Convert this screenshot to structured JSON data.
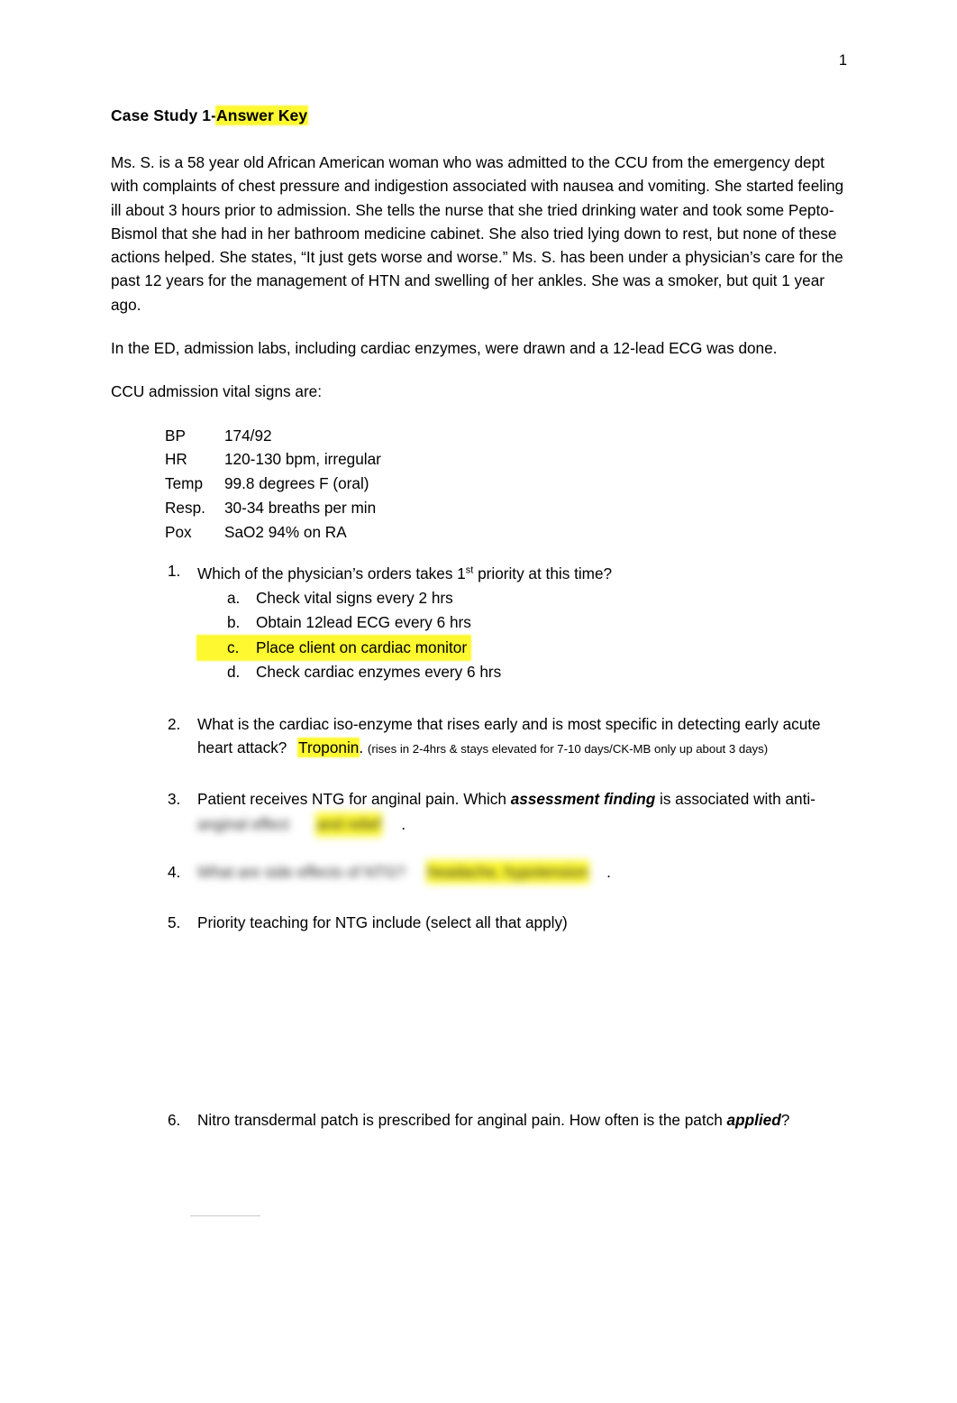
{
  "page": {
    "number": "1"
  },
  "document": {
    "title_prefix": "Case Study 1-",
    "title_highlight": "Answer Key",
    "paragraphs": [
      "Ms. S. is a 58 year old African American woman who was admitted to the CCU from the emergency dept with complaints of chest pressure and indigestion associated with nausea and vomiting. She started feeling ill about 3 hours prior to admission.  She tells the nurse that she tried drinking water and took some Pepto-Bismol that she had in her bathroom medicine cabinet. She also tried lying down to rest, but none of these actions helped.  She states, “It just gets worse and worse.”  Ms. S. has been under a physician’s care for the past 12 years for the management of HTN and swelling of her ankles.  She was a smoker, but quit 1 year ago.",
      "In the ED, admission labs, including cardiac enzymes, were drawn and a 12-lead ECG was done.",
      "CCU admission vital signs are:"
    ]
  },
  "vitals": [
    {
      "label": "BP",
      "value": "174/92"
    },
    {
      "label": "HR",
      "value": "120-130 bpm, irregular"
    },
    {
      "label": "Temp",
      "value": "99.8 degrees F (oral)"
    },
    {
      "label": "Resp.",
      "value": "30-34 breaths per min"
    },
    {
      "label": "Pox",
      "value": "SaO2 94% on RA"
    }
  ],
  "questions": [
    {
      "num": "1.",
      "text_before": "Which of the physician’s orders takes 1",
      "superscript": "st",
      "text_after": " priority at this time?",
      "choices": [
        {
          "letter": "a.",
          "text": "Check vital signs every 2 hrs",
          "highlight": false
        },
        {
          "letter": "b.",
          "text": "Obtain 12lead ECG every 6 hrs",
          "highlight": false
        },
        {
          "letter": "c.",
          "text": "Place client on cardiac monitor",
          "highlight": true
        },
        {
          "letter": "d.",
          "text": "Check cardiac enzymes every 6 hrs",
          "highlight": false
        }
      ]
    },
    {
      "num": "2.",
      "text": "What is the cardiac iso-enzyme that rises early and is most specific in detecting early acute heart attack?",
      "answer": "Troponin",
      "answer_punct": ".",
      "note": "(rises in 2-4hrs & stays elevated for 7-10 days/CK-MB only up about 3 days)"
    },
    {
      "num": "3.",
      "text_start": "Patient receives NTG for anginal pain.  Which ",
      "emphasis1": "assessment",
      "emphasis2": "f",
      "emphasis3": "inding",
      "text_end": " is associated with anti-",
      "redacted_plain": "anginal effect",
      "redacted_highlight": "and relief",
      "trailing": "."
    },
    {
      "num": "4.",
      "redacted_plain": "What are side effects of NTG?",
      "redacted_highlight": "headache, hypotension",
      "trailing": "."
    },
    {
      "num": "5.",
      "text": "Priority teaching for NTG include (select all that apply)"
    },
    {
      "num": "6.",
      "text_start": "Nitro transdermal patch is prescribed for anginal pain.  How often is the patch ",
      "emphasis": "applied",
      "text_end": "?"
    }
  ]
}
